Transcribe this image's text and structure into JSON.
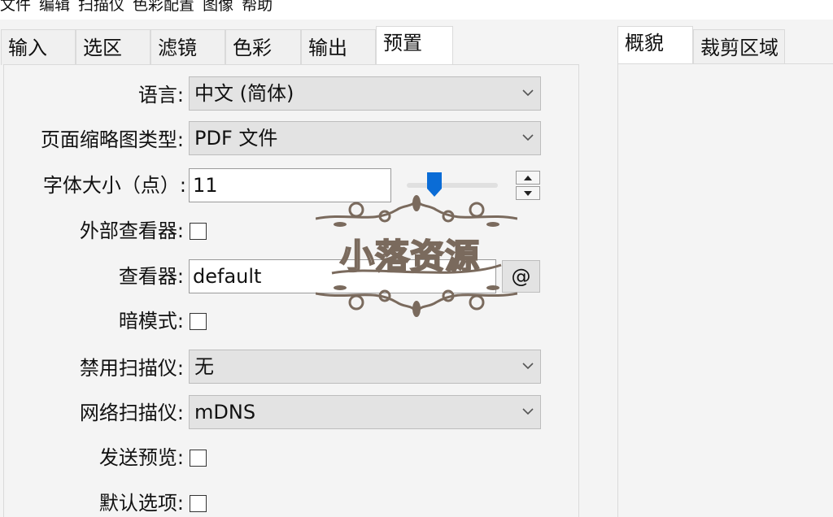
{
  "menubar": {
    "items": [
      "文件",
      "编辑",
      "扫描仪",
      "色彩配置",
      "图像",
      "帮助"
    ]
  },
  "tabs": [
    "输入",
    "选区",
    "滤镜",
    "色彩",
    "输出",
    "预置"
  ],
  "active_tab": "预置",
  "right_tabs": [
    "概貌",
    "裁剪区域"
  ],
  "form": {
    "language_label": "语言:",
    "language_value": "中文 (简体)",
    "thumb_label": "页面缩略图类型:",
    "thumb_value": "PDF 文件",
    "font_label": "字体大小（点）:",
    "font_value": "11",
    "font_slider_fraction": 0.27,
    "external_viewer_label": "外部查看器:",
    "external_viewer_checked": false,
    "viewer_label": "查看器:",
    "viewer_value": "default",
    "viewer_button": "@",
    "dark_mode_label": "暗模式:",
    "dark_mode_checked": false,
    "disable_scanner_label": "禁用扫描仪:",
    "disable_scanner_value": "无",
    "network_scanner_label": "网络扫描仪:",
    "network_scanner_value": "mDNS",
    "send_preview_label": "发送预览:",
    "send_preview_checked": false,
    "default_options_label": "默认选项:",
    "default_options_checked": false
  },
  "watermark": {
    "text": "小落资源"
  },
  "colors": {
    "accent": "#0a6cd6",
    "panel": "#f4f4f4",
    "combo": "#e3e3e3",
    "watermark_brown": "#7a6a5d"
  }
}
